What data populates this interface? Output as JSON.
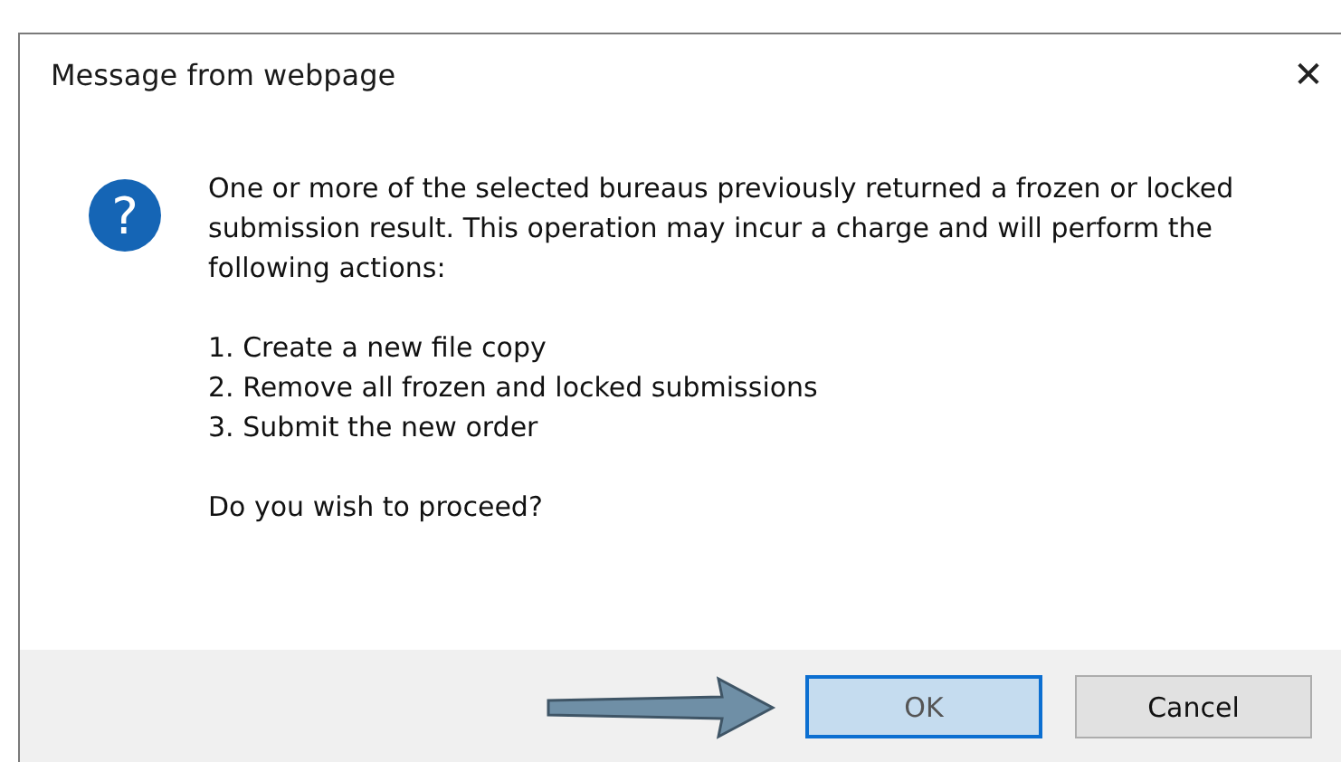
{
  "window": {
    "title": "Message from webpage",
    "close": "✕"
  },
  "message": {
    "icon": "?",
    "intro": "One or more of the selected bureaus previously returned a frozen or locked submission result. This operation may incur a charge and will perform the following actions:",
    "steps": [
      "1. Create a new file copy",
      "2. Remove all frozen and locked submissions",
      "3. Submit the new order"
    ],
    "question": "Do you wish to proceed?"
  },
  "buttons": [
    {
      "label": "OK",
      "default": true
    },
    {
      "label": "Cancel",
      "default": false
    }
  ]
}
